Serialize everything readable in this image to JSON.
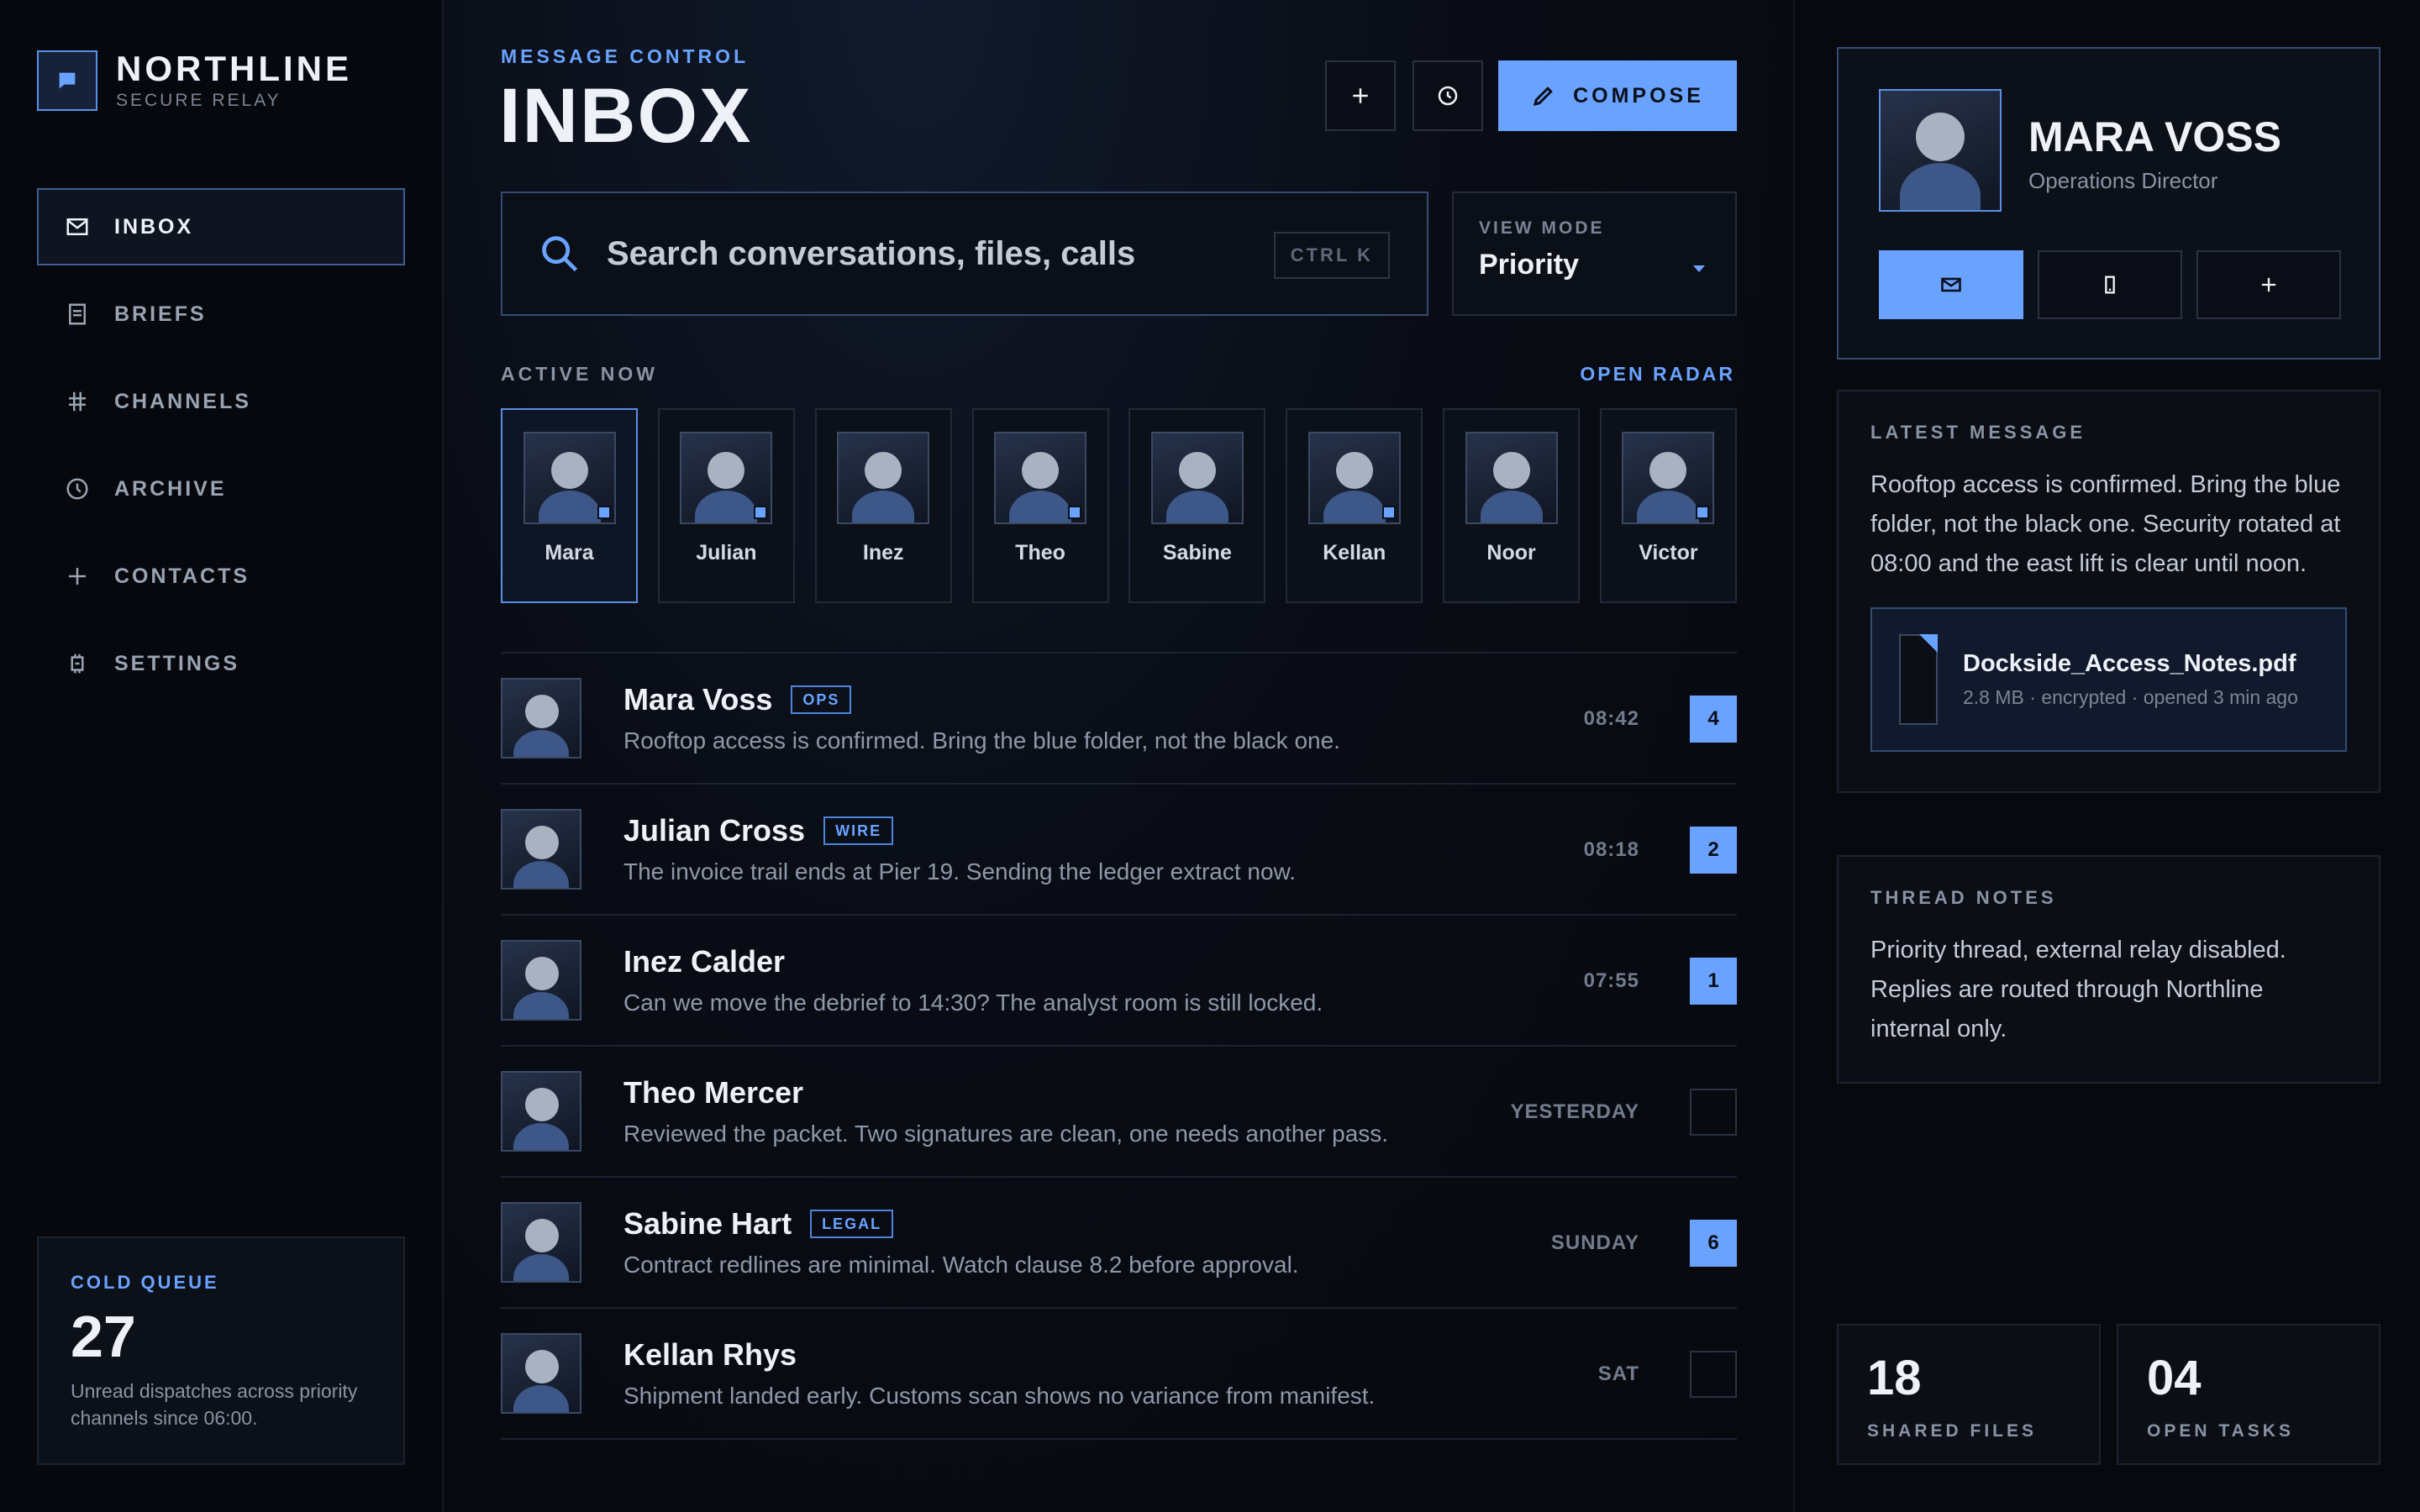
{
  "brand": {
    "name": "NORTHLINE",
    "subtitle": "SECURE RELAY"
  },
  "sidebar": {
    "items": [
      {
        "label": "INBOX",
        "icon": "mail-icon",
        "active": true
      },
      {
        "label": "BRIEFS",
        "icon": "document-icon",
        "active": false
      },
      {
        "label": "CHANNELS",
        "icon": "channels-icon",
        "active": false
      },
      {
        "label": "ARCHIVE",
        "icon": "clock-icon",
        "active": false
      },
      {
        "label": "CONTACTS",
        "icon": "plus-icon",
        "active": false
      },
      {
        "label": "SETTINGS",
        "icon": "settings-icon",
        "active": false
      }
    ],
    "cold_queue": {
      "label": "COLD QUEUE",
      "value": "27",
      "description": "Unread dispatches across priority channels since 06:00."
    }
  },
  "header": {
    "eyebrow": "MESSAGE CONTROL",
    "title": "INBOX",
    "compose_label": "COMPOSE"
  },
  "search": {
    "placeholder": "Search conversations, files, calls",
    "shortcut": "CTRL K"
  },
  "view_mode": {
    "label": "VIEW MODE",
    "value": "Priority"
  },
  "active_now": {
    "label": "ACTIVE NOW",
    "link": "OPEN RADAR",
    "contacts": [
      {
        "name": "Mara",
        "online": true,
        "selected": true
      },
      {
        "name": "Julian",
        "online": true,
        "selected": false
      },
      {
        "name": "Inez",
        "online": false,
        "selected": false
      },
      {
        "name": "Theo",
        "online": true,
        "selected": false
      },
      {
        "name": "Sabine",
        "online": false,
        "selected": false
      },
      {
        "name": "Kellan",
        "online": true,
        "selected": false
      },
      {
        "name": "Noor",
        "online": false,
        "selected": false
      },
      {
        "name": "Victor",
        "online": true,
        "selected": false
      }
    ]
  },
  "messages": [
    {
      "name": "Mara Voss",
      "tag": "OPS",
      "preview": "Rooftop access is confirmed. Bring the blue folder, not the black one.",
      "time": "08:42",
      "count": "4"
    },
    {
      "name": "Julian Cross",
      "tag": "WIRE",
      "preview": "The invoice trail ends at Pier 19. Sending the ledger extract now.",
      "time": "08:18",
      "count": "2"
    },
    {
      "name": "Inez Calder",
      "tag": "",
      "preview": "Can we move the debrief to 14:30? The analyst room is still locked.",
      "time": "07:55",
      "count": "1"
    },
    {
      "name": "Theo Mercer",
      "tag": "",
      "preview": "Reviewed the packet. Two signatures are clean, one needs another pass.",
      "time": "YESTERDAY",
      "count": ""
    },
    {
      "name": "Sabine Hart",
      "tag": "LEGAL",
      "preview": "Contract redlines are minimal. Watch clause 8.2 before approval.",
      "time": "SUNDAY",
      "count": "6"
    },
    {
      "name": "Kellan Rhys",
      "tag": "",
      "preview": "Shipment landed early. Customs scan shows no variance from manifest.",
      "time": "SAT",
      "count": ""
    }
  ],
  "profile": {
    "name": "MARA VOSS",
    "role": "Operations Director"
  },
  "latest_message": {
    "label": "LATEST MESSAGE",
    "text": "Rooftop access is confirmed. Bring the blue folder, not the black one. Security rotated at 08:00 and the east lift is clear until noon.",
    "attachment": {
      "name": "Dockside_Access_Notes.pdf",
      "meta": "2.8 MB · encrypted · opened 3 min ago"
    }
  },
  "thread_notes": {
    "label": "THREAD NOTES",
    "text": "Priority thread, external relay disabled. Replies are routed through Northline internal only."
  },
  "stats": [
    {
      "value": "18",
      "label": "SHARED FILES"
    },
    {
      "value": "04",
      "label": "OPEN TASKS"
    }
  ],
  "colors": {
    "accent": "#6aa3ff",
    "background": "#07090f",
    "border": "#1b2230"
  }
}
